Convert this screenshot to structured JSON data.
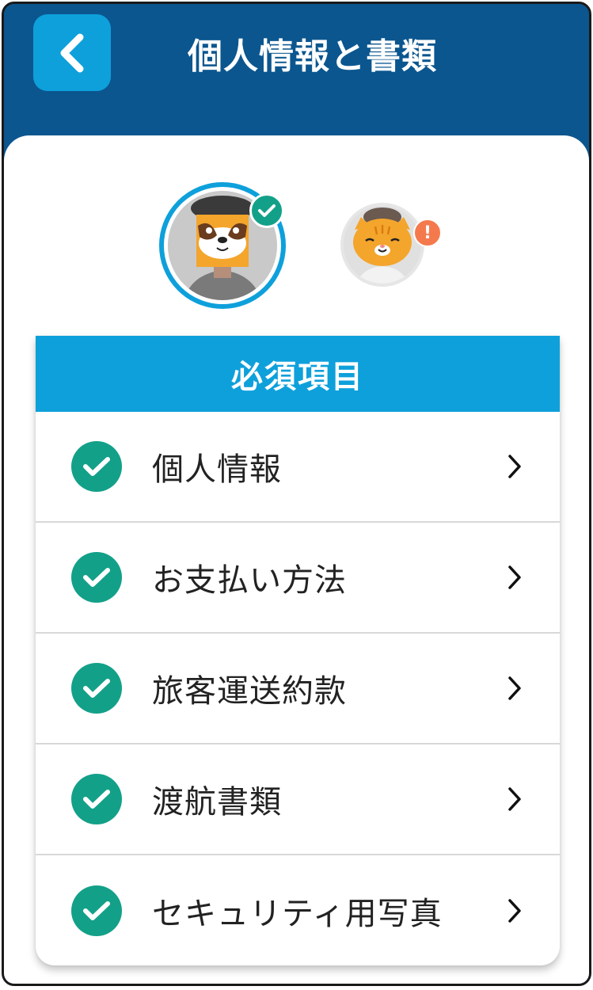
{
  "header": {
    "title": "個人情報と書類",
    "back_icon": "chevron-left-icon"
  },
  "avatars": [
    {
      "status": "complete",
      "badge_icon": "check-icon"
    },
    {
      "status": "warning",
      "badge_text": "!"
    }
  ],
  "section": {
    "title": "必須項目",
    "items": [
      {
        "label": "個人情報",
        "status_icon": "check-circle-icon"
      },
      {
        "label": "お支払い方法",
        "status_icon": "check-circle-icon"
      },
      {
        "label": "旅客運送約款",
        "status_icon": "check-circle-icon"
      },
      {
        "label": "渡航書類",
        "status_icon": "check-circle-icon"
      },
      {
        "label": "セキュリティ用写真",
        "status_icon": "check-circle-icon"
      }
    ]
  },
  "colors": {
    "header_bg": "#0b568f",
    "accent": "#0ea0db",
    "success": "#13a089",
    "warning": "#f47a4d"
  }
}
